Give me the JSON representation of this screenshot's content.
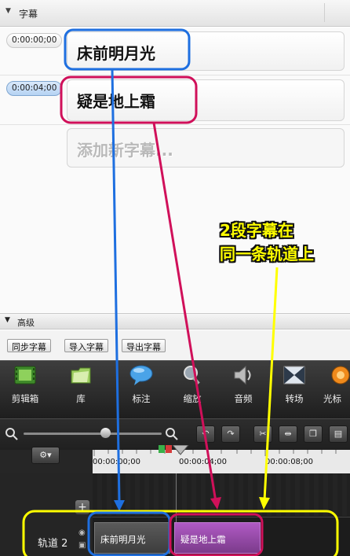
{
  "captions_panel": {
    "title": "字幕"
  },
  "captions": [
    {
      "time": "0:00:00;00",
      "text": "床前明月光"
    },
    {
      "time": "0:00:04;00",
      "text": "疑是地上霜"
    }
  ],
  "add_caption_placeholder": "添加新字幕...",
  "callout": {
    "line1": "2段字幕在",
    "line2": "同一条轨道上"
  },
  "advanced": {
    "title": "高级",
    "buttons": {
      "sync": "同步字幕",
      "import": "导入字幕",
      "export": "导出字幕"
    }
  },
  "toolbar": {
    "items": [
      {
        "label": "剪辑箱",
        "icon": "film-strip-icon"
      },
      {
        "label": "库",
        "icon": "library-folder-icon"
      },
      {
        "label": "标注",
        "icon": "speech-bubble-icon"
      },
      {
        "label": "缩放",
        "icon": "zoom-magnifier-icon"
      },
      {
        "label": "音频",
        "icon": "speaker-icon"
      },
      {
        "label": "转场",
        "icon": "transition-icon"
      },
      {
        "label": "光标",
        "icon": "cursor-effects-icon"
      }
    ]
  },
  "timeline": {
    "ruler_labels": [
      "00:00:00;00",
      "00:00:04;00",
      "00:00:08;00"
    ],
    "track_label": "轨道 2",
    "clips": [
      "床前明月光",
      "疑是地上霜"
    ]
  },
  "colors": {
    "highlight_blue": "#1e6fe0",
    "highlight_pink": "#d0105a",
    "callout_yellow": "#ffff00",
    "clip_purple": "#9a4bb0"
  }
}
